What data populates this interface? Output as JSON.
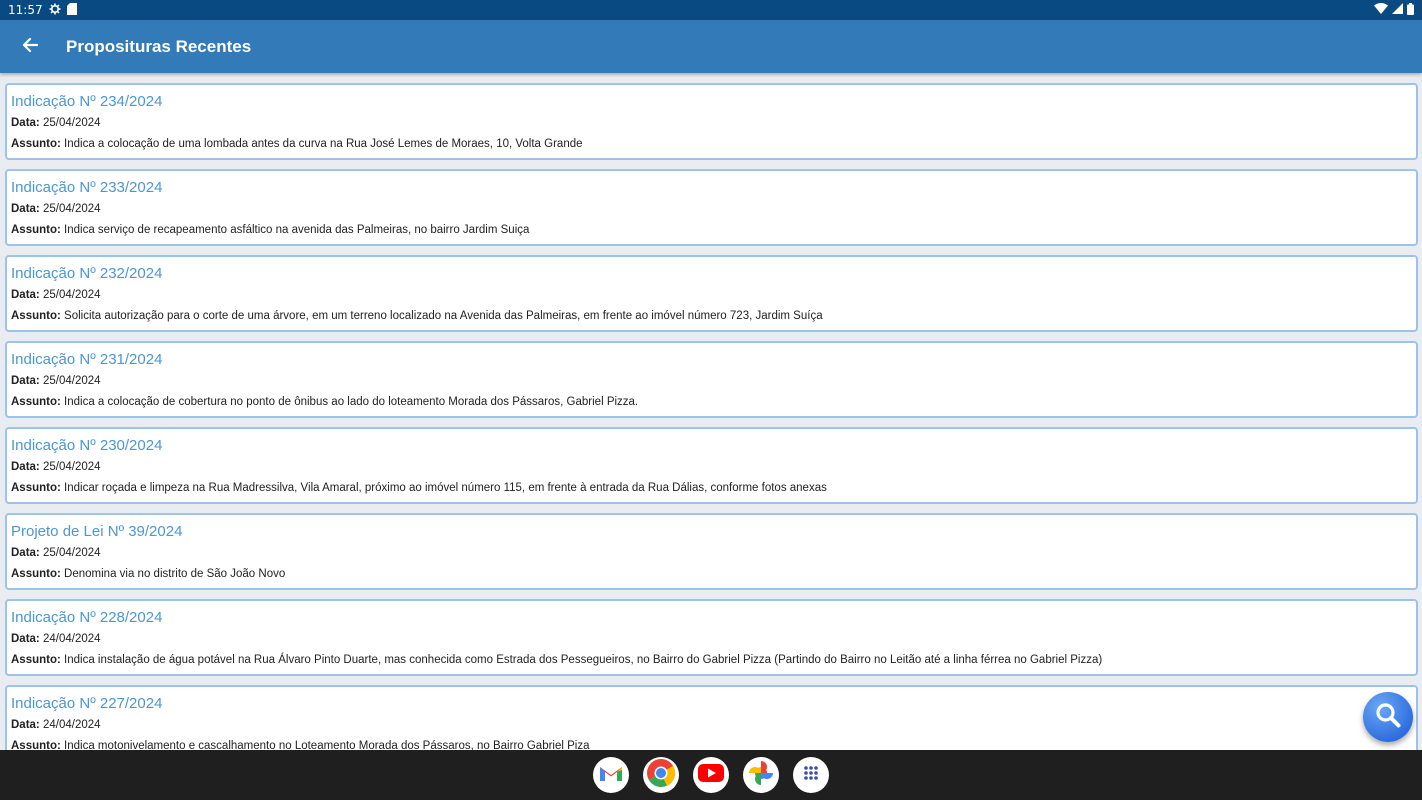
{
  "status_bar": {
    "time": "11:57"
  },
  "app_bar": {
    "title": "Proposituras Recentes"
  },
  "labels": {
    "date": "Data:",
    "subject": "Assunto:"
  },
  "items": [
    {
      "title": "Indicação Nº 234/2024",
      "date": "25/04/2024",
      "subject": "Indica a colocação de uma lombada antes da curva na Rua José Lemes de Moraes, 10, Volta Grande"
    },
    {
      "title": "Indicação Nº 233/2024",
      "date": "25/04/2024",
      "subject": "Indica serviço de recapeamento asfáltico na avenida das Palmeiras, no bairro Jardim Suiça"
    },
    {
      "title": "Indicação Nº 232/2024",
      "date": "25/04/2024",
      "subject": "Solicita autorização para o corte de uma árvore, em um terreno localizado na Avenida das Palmeiras, em frente ao imóvel número 723, Jardim Suíça"
    },
    {
      "title": "Indicação Nº 231/2024",
      "date": "25/04/2024",
      "subject": "Indica a colocação de cobertura no ponto de ônibus ao lado do loteamento Morada dos Pássaros, Gabriel Pizza."
    },
    {
      "title": "Indicação Nº 230/2024",
      "date": "25/04/2024",
      "subject": "Indicar roçada e limpeza na Rua Madressilva, Vila Amaral, próximo ao imóvel número 115, em frente à entrada da Rua Dálias, conforme fotos anexas"
    },
    {
      "title": "Projeto de Lei Nº 39/2024",
      "date": "25/04/2024",
      "subject": "Denomina via no distrito de São João Novo"
    },
    {
      "title": "Indicação Nº 228/2024",
      "date": "24/04/2024",
      "subject": "Indica instalação de água potável na Rua Álvaro Pinto Duarte, mas conhecida como Estrada dos Pessegueiros, no Bairro do Gabriel Pizza (Partindo do Bairro no Leitão até a linha férrea no Gabriel Pizza)"
    },
    {
      "title": "Indicação Nº 227/2024",
      "date": "24/04/2024",
      "subject": "Indica motonivelamento e cascalhamento no Loteamento Morada dos Pássaros, no Bairro Gabriel Piza"
    }
  ],
  "icons": {
    "back": "arrow-left-icon",
    "fab": "search-icon",
    "dock": [
      "gmail-icon",
      "chrome-icon",
      "youtube-icon",
      "photos-icon",
      "app-drawer-icon"
    ]
  },
  "colors": {
    "status_bar": "#0a4a82",
    "app_bar": "#337ab9",
    "card_title": "#4a97d6",
    "card_border": "#9ec3ea",
    "fab": "#2f6fe0",
    "nav_bar": "#1f1f1f"
  }
}
